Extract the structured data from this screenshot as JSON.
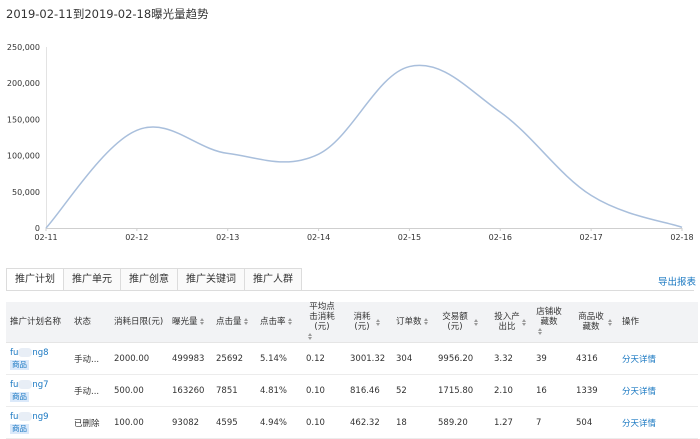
{
  "title": "2019-02-11到2019-02-18曝光量趋势",
  "chart_data": {
    "type": "line",
    "title": "2019-02-11到2019-02-18曝光量趋势",
    "xlabel": "",
    "ylabel": "",
    "categories": [
      "02-11",
      "02-12",
      "02-13",
      "02-14",
      "02-15",
      "02-16",
      "02-17",
      "02-18"
    ],
    "series": [
      {
        "values": [
          0,
          135000,
          103000,
          102000,
          223000,
          160000,
          45000,
          1000
        ]
      }
    ],
    "ylim": [
      0,
      250000
    ],
    "yticks": [
      0,
      50000,
      100000,
      150000,
      200000,
      250000
    ],
    "ytick_labels": [
      "0",
      "50,000",
      "100,000",
      "150,000",
      "200,000",
      "250,000"
    ],
    "line_color": "#a9bfdc",
    "grid": false,
    "legend": "none"
  },
  "tabs": [
    "推广计划",
    "推广单元",
    "推广创意",
    "推广关键词",
    "推广人群"
  ],
  "export_label": "导出报表",
  "table": {
    "headers": [
      "推广计划名称",
      "状态",
      "消耗日限(元)",
      "曝光量",
      "点击量",
      "点击率",
      "平均点击消耗(元)",
      "消耗(元)",
      "订单数",
      "交易额(元)",
      "投入产出比",
      "店铺收藏数",
      "商品收藏数",
      "操作"
    ],
    "rows": [
      {
        "name_a": "fu",
        "name_b": "ng8",
        "tag": "商品",
        "status": "手动...",
        "limit": "2000.00",
        "impr": "499983",
        "clicks": "25692",
        "ctr": "5.14%",
        "cpc": "0.12",
        "cost": "3001.32",
        "orders": "304",
        "gmv": "9956.20",
        "roi": "3.32",
        "shop_fav": "39",
        "item_fav": "4316",
        "action": "分天详情"
      },
      {
        "name_a": "fu",
        "name_b": "ng7",
        "tag": "商品",
        "status": "手动...",
        "limit": "500.00",
        "impr": "163260",
        "clicks": "7851",
        "ctr": "4.81%",
        "cpc": "0.10",
        "cost": "816.46",
        "orders": "52",
        "gmv": "1715.80",
        "roi": "2.10",
        "shop_fav": "16",
        "item_fav": "1339",
        "action": "分天详情"
      },
      {
        "name_a": "fu",
        "name_b": "ng9",
        "tag": "商品",
        "status": "已删除",
        "limit": "100.00",
        "impr": "93082",
        "clicks": "4595",
        "ctr": "4.94%",
        "cpc": "0.10",
        "cost": "462.32",
        "orders": "18",
        "gmv": "589.20",
        "roi": "1.27",
        "shop_fav": "7",
        "item_fav": "504",
        "action": "分天详情"
      }
    ]
  }
}
